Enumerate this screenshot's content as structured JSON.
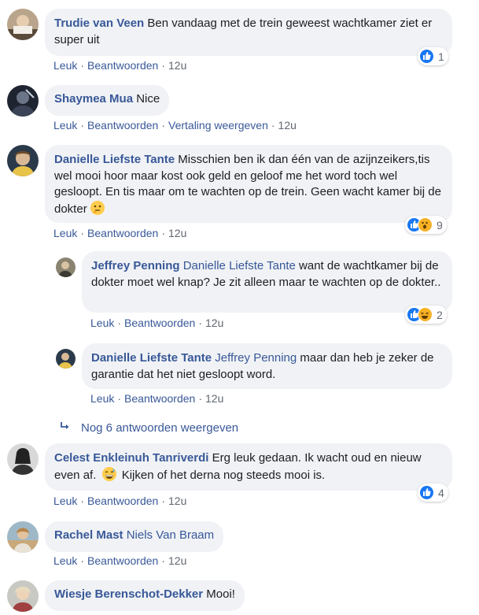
{
  "actions": {
    "like": "Leuk",
    "reply": "Beantwoorden",
    "translate": "Vertaling weergeven",
    "sep": "·"
  },
  "comments": [
    {
      "name": "Trudie van Veen",
      "text": "Ben vandaag met de trein geweest wachtkamer ziet er super uit",
      "time": "12u",
      "reactions": {
        "count": "1",
        "types": [
          "like"
        ]
      }
    },
    {
      "name": "Shaymea Mua",
      "text": "Nice",
      "time": "12u"
    },
    {
      "name": "Danielle Liefste Tante",
      "text": "Misschien ben ik dan één van de azijnzeikers,tis wel mooi hoor maar kost ook geld en geloof me het word toch wel gesloopt. En tis maar om te wachten op de trein. Geen wacht kamer bij de dokter",
      "emoji": "thinking-face",
      "time": "12u",
      "reactions": {
        "count": "9",
        "types": [
          "like",
          "wow"
        ]
      }
    },
    {
      "name": "Jeffrey Penning",
      "mention": "Danielle Liefste Tante",
      "text": "want de wachtkamer bij de dokter moet wel knap? Je zit alleen maar te wachten op de dokter..",
      "time": "12u",
      "reactions": {
        "count": "2",
        "types": [
          "like",
          "haha"
        ]
      }
    },
    {
      "name": "Danielle Liefste Tante",
      "mention": "Jeffrey Penning",
      "text": "maar dan heb je zeker de garantie dat het niet gesloopt word.",
      "time": "12u"
    },
    {
      "name": "Celest Enkleinuh Tanriverdi",
      "text": "Erg leuk gedaan. Ik wacht oud en nieuw even af.",
      "text2": "Kijken of het derna nog steeds mooi is.",
      "emoji": "grinning-sweat-face",
      "time": "12u",
      "reactions": {
        "count": "4",
        "types": [
          "like"
        ]
      }
    },
    {
      "name": "Rachel Mast",
      "mention": "Niels Van Braam",
      "time": "12u"
    },
    {
      "name": "Wiesje Berenschot-Dekker",
      "text": "Mooi!"
    }
  ],
  "more_replies": {
    "icon": "reply-arrow-icon",
    "label": "Nog 6 antwoorden weergeven"
  },
  "colors": {
    "link": "#385898",
    "bubble": "#f0f2f5",
    "like": "#1877f2",
    "meta": "#606770"
  }
}
